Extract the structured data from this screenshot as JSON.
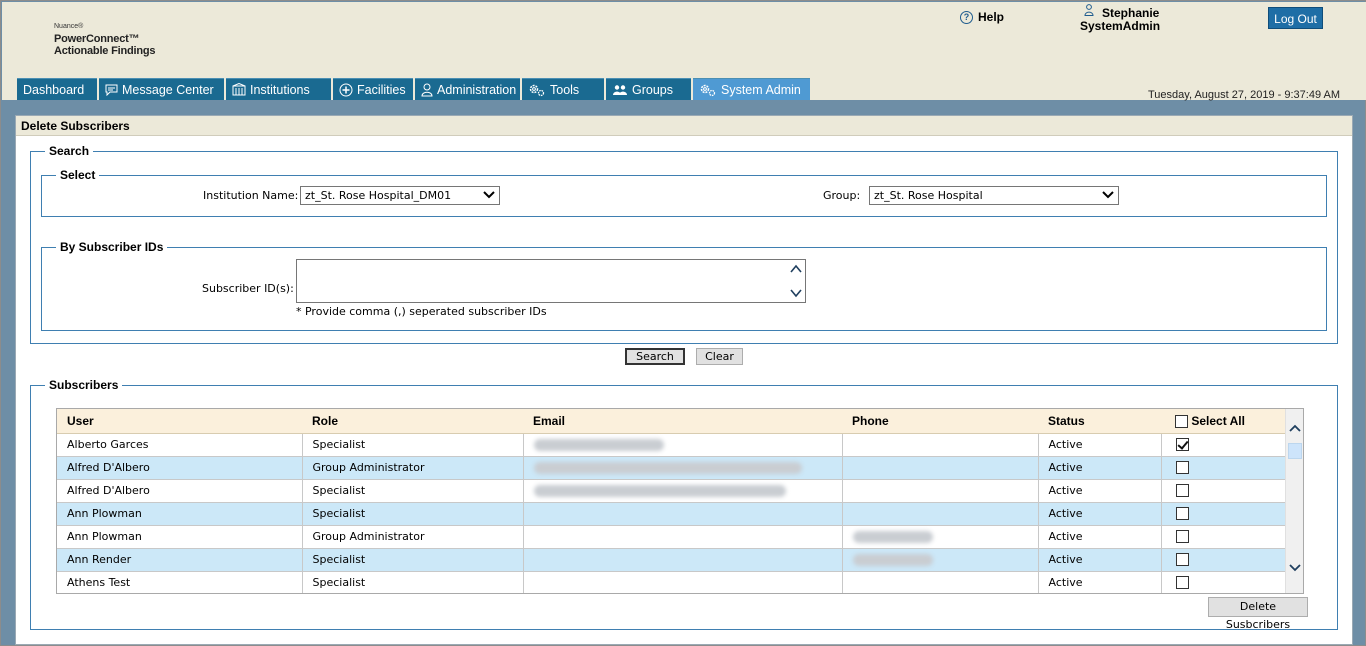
{
  "header": {
    "brand": "Nuance®",
    "product_line1": "PowerConnect™",
    "product_line2": "Actionable Findings",
    "help_label": "Help",
    "user_first": "Stephanie",
    "user_role": "SystemAdmin",
    "logout_label": "Log Out",
    "datetime": "Tuesday, August 27, 2019 - 9:37:49 AM",
    "accent_color": "#1a6a91"
  },
  "nav": {
    "tabs": [
      {
        "label": "Dashboard",
        "icon": ""
      },
      {
        "label": "Message Center",
        "icon": "chat-icon"
      },
      {
        "label": "Institutions",
        "icon": "building-icon"
      },
      {
        "label": "Facilities",
        "icon": "plus-circle-icon"
      },
      {
        "label": "Administration",
        "icon": "person-icon"
      },
      {
        "label": "Tools",
        "icon": "gears-icon"
      },
      {
        "label": "Groups",
        "icon": "people-icon"
      },
      {
        "label": "System Admin",
        "icon": "gears-icon",
        "active": true
      }
    ]
  },
  "panel": {
    "title": "Delete Subscribers",
    "search_legend": "Search",
    "select_legend": "Select",
    "institution_label": "Institution Name:",
    "institution_value": "zt_St. Rose Hospital_DM01",
    "group_label": "Group:",
    "group_value": "zt_St. Rose Hospital",
    "by_ids_legend": "By Subscriber IDs",
    "subscriber_ids_label": "Subscriber ID(s):",
    "subscriber_ids_value": "",
    "hint": "* Provide comma (,) seperated subscriber IDs",
    "search_button": "Search",
    "clear_button": "Clear",
    "subscribers_legend": "Subscribers",
    "delete_button": "Delete Susbcribers"
  },
  "table": {
    "columns": [
      "User",
      "Role",
      "Email",
      "Phone",
      "Status",
      "Select All"
    ],
    "rows": [
      {
        "user": "Alberto Garces",
        "role": "Specialist",
        "email_blur": 130,
        "phone_blur": 0,
        "status": "Active",
        "checked": true
      },
      {
        "user": "Alfred D'Albero",
        "role": "Group Administrator",
        "email_blur": 268,
        "phone_blur": 0,
        "status": "Active",
        "checked": false
      },
      {
        "user": "Alfred D'Albero",
        "role": "Specialist",
        "email_blur": 252,
        "phone_blur": 0,
        "status": "Active",
        "checked": false
      },
      {
        "user": "Ann Plowman",
        "role": "Specialist",
        "email_blur": 0,
        "phone_blur": 0,
        "status": "Active",
        "checked": false
      },
      {
        "user": "Ann Plowman",
        "role": "Group Administrator",
        "email_blur": 0,
        "phone_blur": 80,
        "status": "Active",
        "checked": false
      },
      {
        "user": "Ann Render",
        "role": "Specialist",
        "email_blur": 0,
        "phone_blur": 80,
        "status": "Active",
        "checked": false
      },
      {
        "user": "Athens Test",
        "role": "Specialist",
        "email_blur": 0,
        "phone_blur": 0,
        "status": "Active",
        "checked": false
      }
    ]
  }
}
